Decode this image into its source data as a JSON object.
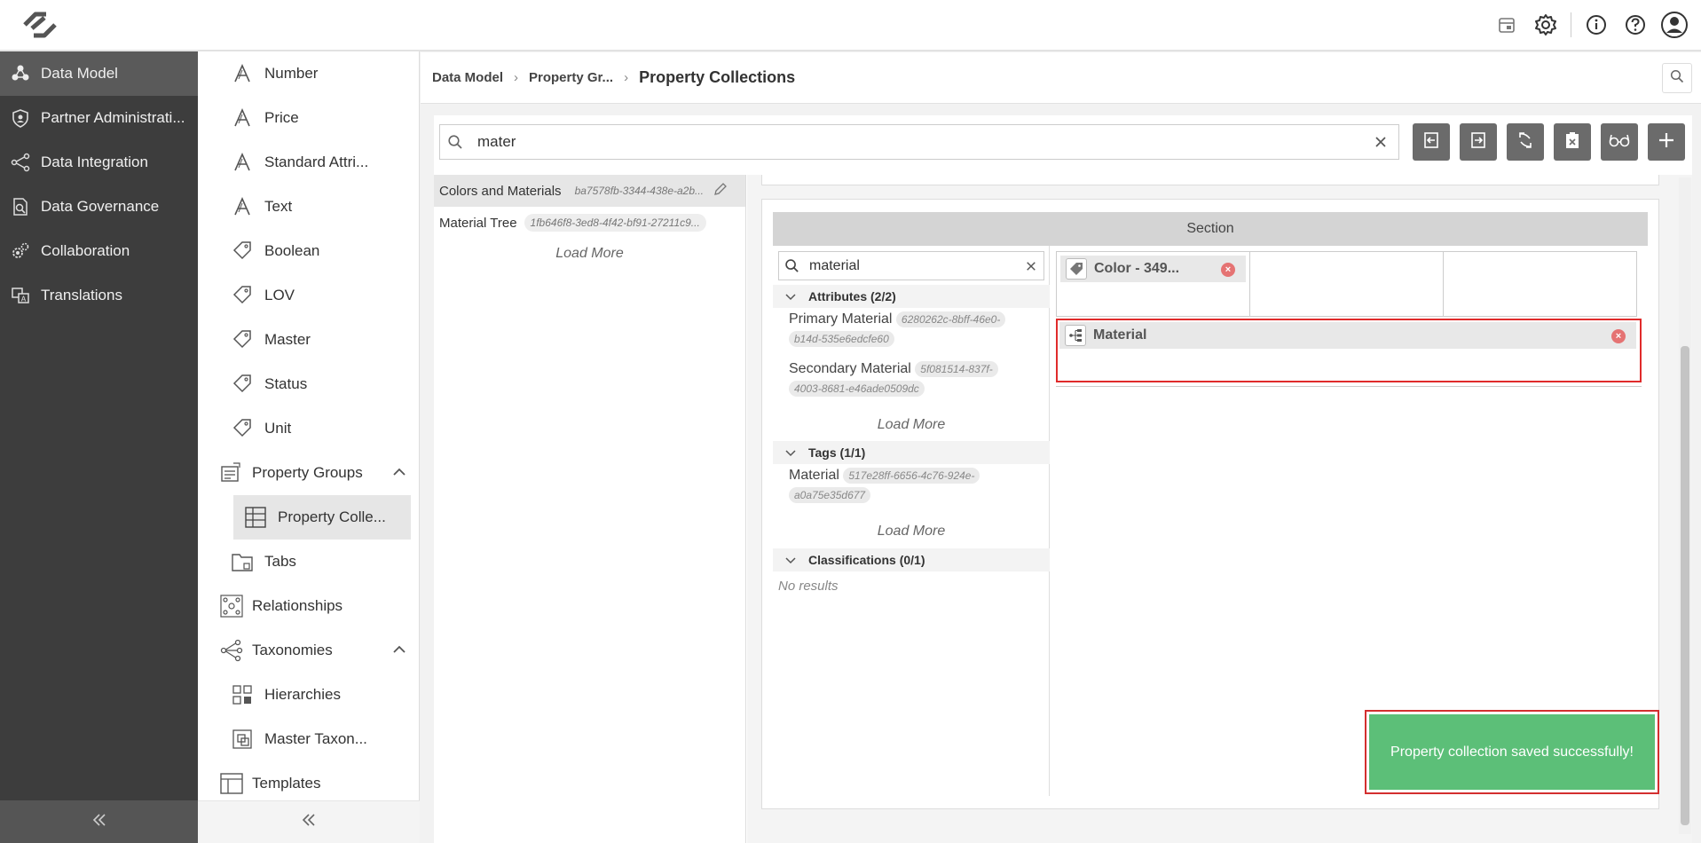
{
  "leftnav": {
    "items": [
      {
        "label": "Data Model",
        "icon": "data-model-icon",
        "active": true
      },
      {
        "label": "Partner Administrati...",
        "icon": "shield-icon"
      },
      {
        "label": "Data Integration",
        "icon": "share-nodes-icon"
      },
      {
        "label": "Data Governance",
        "icon": "document-search-icon"
      },
      {
        "label": "Collaboration",
        "icon": "gears-icon"
      },
      {
        "label": "Translations",
        "icon": "translate-icon"
      }
    ]
  },
  "subnav": {
    "items": [
      {
        "label": "Number",
        "icon": "attribute-a-icon"
      },
      {
        "label": "Price",
        "icon": "attribute-a-icon"
      },
      {
        "label": "Standard Attri...",
        "icon": "attribute-a-icon"
      },
      {
        "label": "Text",
        "icon": "attribute-a-icon"
      },
      {
        "label": "Boolean",
        "icon": "tag-icon"
      },
      {
        "label": "LOV",
        "icon": "tag-icon"
      },
      {
        "label": "Master",
        "icon": "tag-icon"
      },
      {
        "label": "Status",
        "icon": "tag-icon"
      },
      {
        "label": "Unit",
        "icon": "tag-icon"
      },
      {
        "label": "Property Groups",
        "icon": "property-groups-icon"
      },
      {
        "label": "Property Colle...",
        "icon": "table-icon"
      },
      {
        "label": "Tabs",
        "icon": "tabs-icon"
      },
      {
        "label": "Relationships",
        "icon": "relationships-icon"
      },
      {
        "label": "Taxonomies",
        "icon": "taxonomy-icon"
      },
      {
        "label": "Hierarchies",
        "icon": "hierarchy-grid-icon"
      },
      {
        "label": "Master Taxon...",
        "icon": "master-taxonomy-icon"
      },
      {
        "label": "Templates",
        "icon": "templates-icon"
      }
    ]
  },
  "breadcrumb": {
    "part1": "Data Model",
    "part2": "Property Gr...",
    "current": "Property Collections"
  },
  "search": {
    "value": "mater"
  },
  "list": {
    "rows": [
      {
        "name": "Colors and Materials",
        "id": "ba7578fb-3344-438e-a2b..."
      },
      {
        "name": "Material Tree",
        "id": "1fb646f8-3ed8-4f42-bf91-27211c9..."
      }
    ],
    "load_more": "Load More"
  },
  "editor": {
    "section_title": "Section",
    "palette_search": "material",
    "groups": [
      {
        "title": "Attributes (2/2)",
        "items": [
          {
            "name": "Primary Material",
            "id_a": "6280262c-8bff-46e0-",
            "id_b": "b14d-535e6edcfe60"
          },
          {
            "name": "Secondary Material",
            "id_a": "5f081514-837f-",
            "id_b": "4003-8681-e46ade0509dc"
          }
        ],
        "load_more": "Load More"
      },
      {
        "title": "Tags (1/1)",
        "items": [
          {
            "name": "Material",
            "id_a": "517e28ff-6656-4c76-924e-",
            "id_b": "a0a75e35d677"
          }
        ],
        "load_more": "Load More"
      },
      {
        "title": "Classifications (0/1)",
        "no_results": "No results"
      }
    ],
    "cells": {
      "color_chip": "Color - 349...",
      "material_chip": "Material"
    }
  },
  "toast": {
    "message": "Property collection saved successfully!"
  },
  "colors": {
    "toast": "#5cbf78",
    "highlight": "#e02b2b",
    "nav_bg": "#3d3d3d"
  }
}
